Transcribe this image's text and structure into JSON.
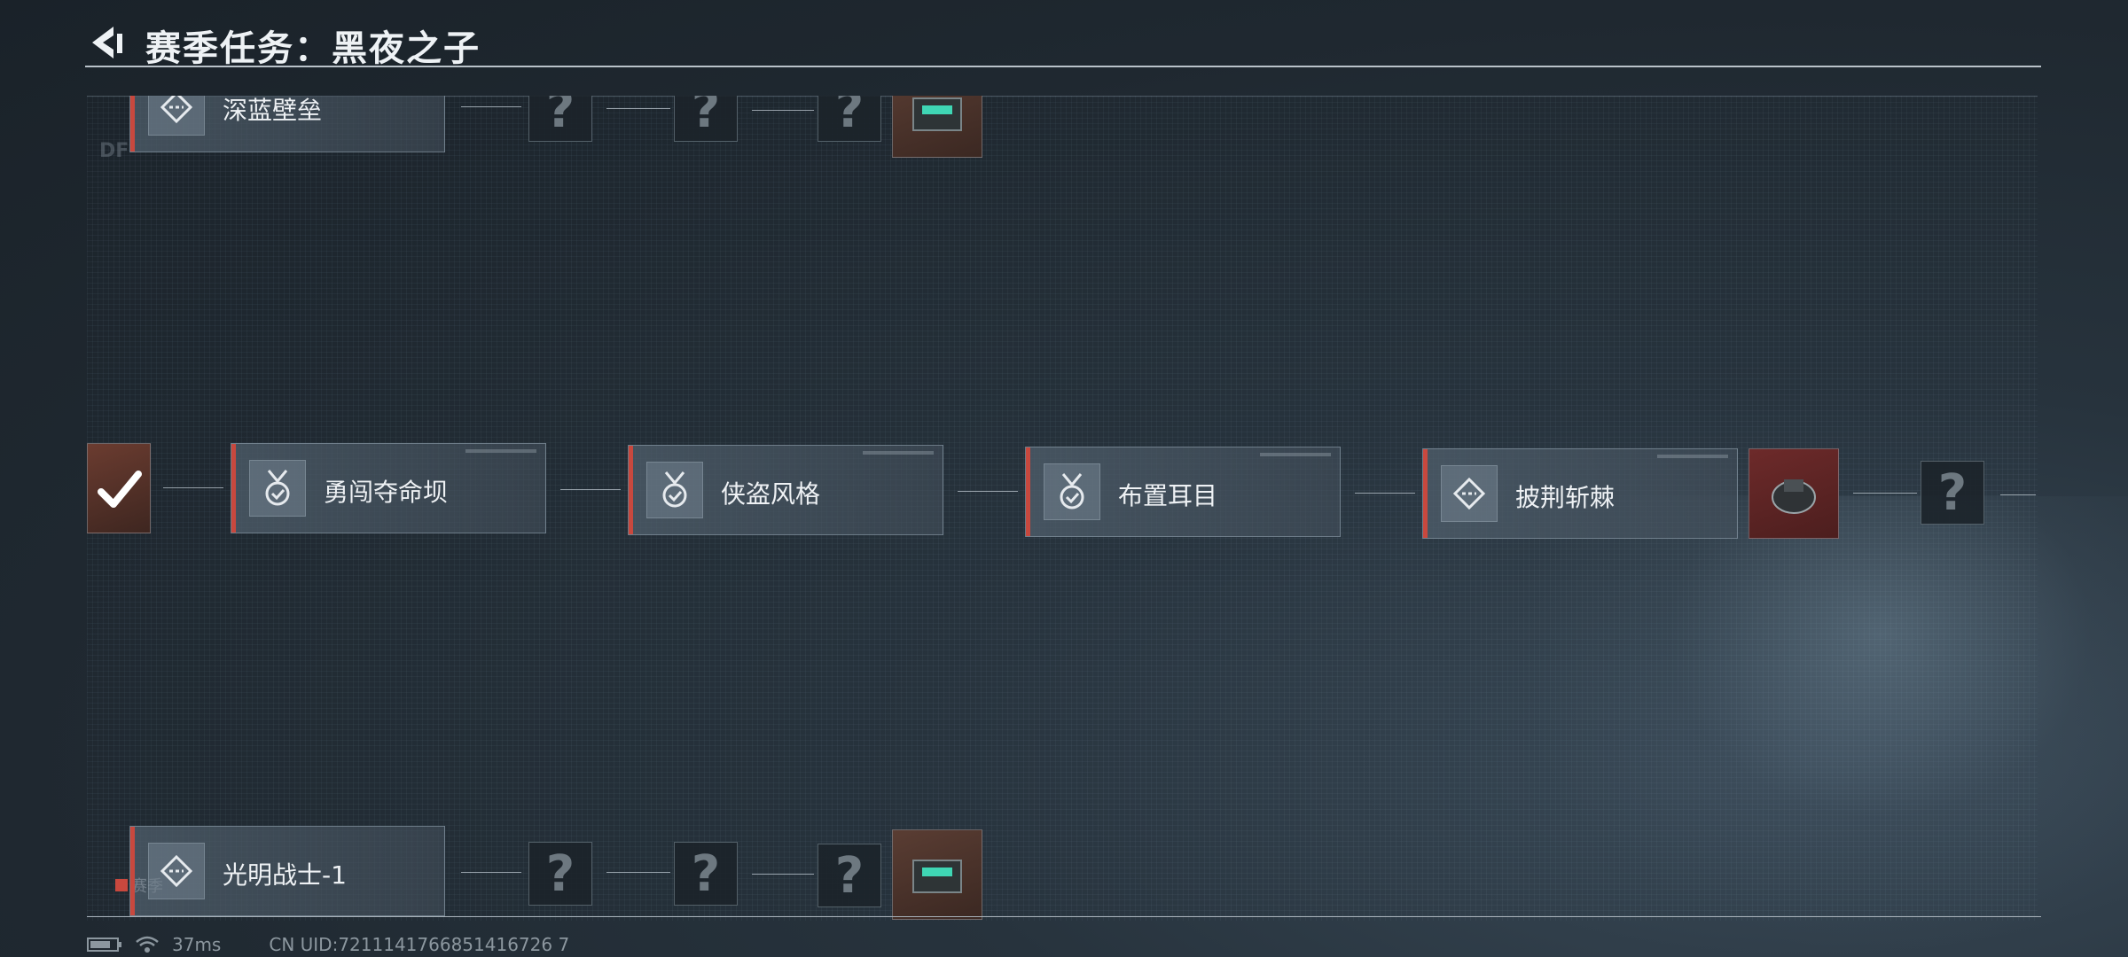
{
  "header": {
    "title": "赛季任务：黑夜之子"
  },
  "row_top": {
    "mission_label": "深蓝壁垒"
  },
  "row_mid": {
    "missions": [
      {
        "label": "勇闯夺命坝",
        "icon": "medal-check-icon"
      },
      {
        "label": "侠盗风格",
        "icon": "medal-check-icon"
      },
      {
        "label": "布置耳目",
        "icon": "medal-check-icon"
      },
      {
        "label": "披荆斩棘",
        "icon": "diamond-icon"
      }
    ],
    "locked_symbol": "?"
  },
  "row_bottom": {
    "mission_label": "光明战士-1",
    "locked_symbol": "?",
    "season_tag": "赛季"
  },
  "status_bar": {
    "ping": "37ms",
    "uid": "CN UID:7211141766851416726 7"
  },
  "colors": {
    "accent": "#c8483e",
    "background": "#1f2830"
  }
}
